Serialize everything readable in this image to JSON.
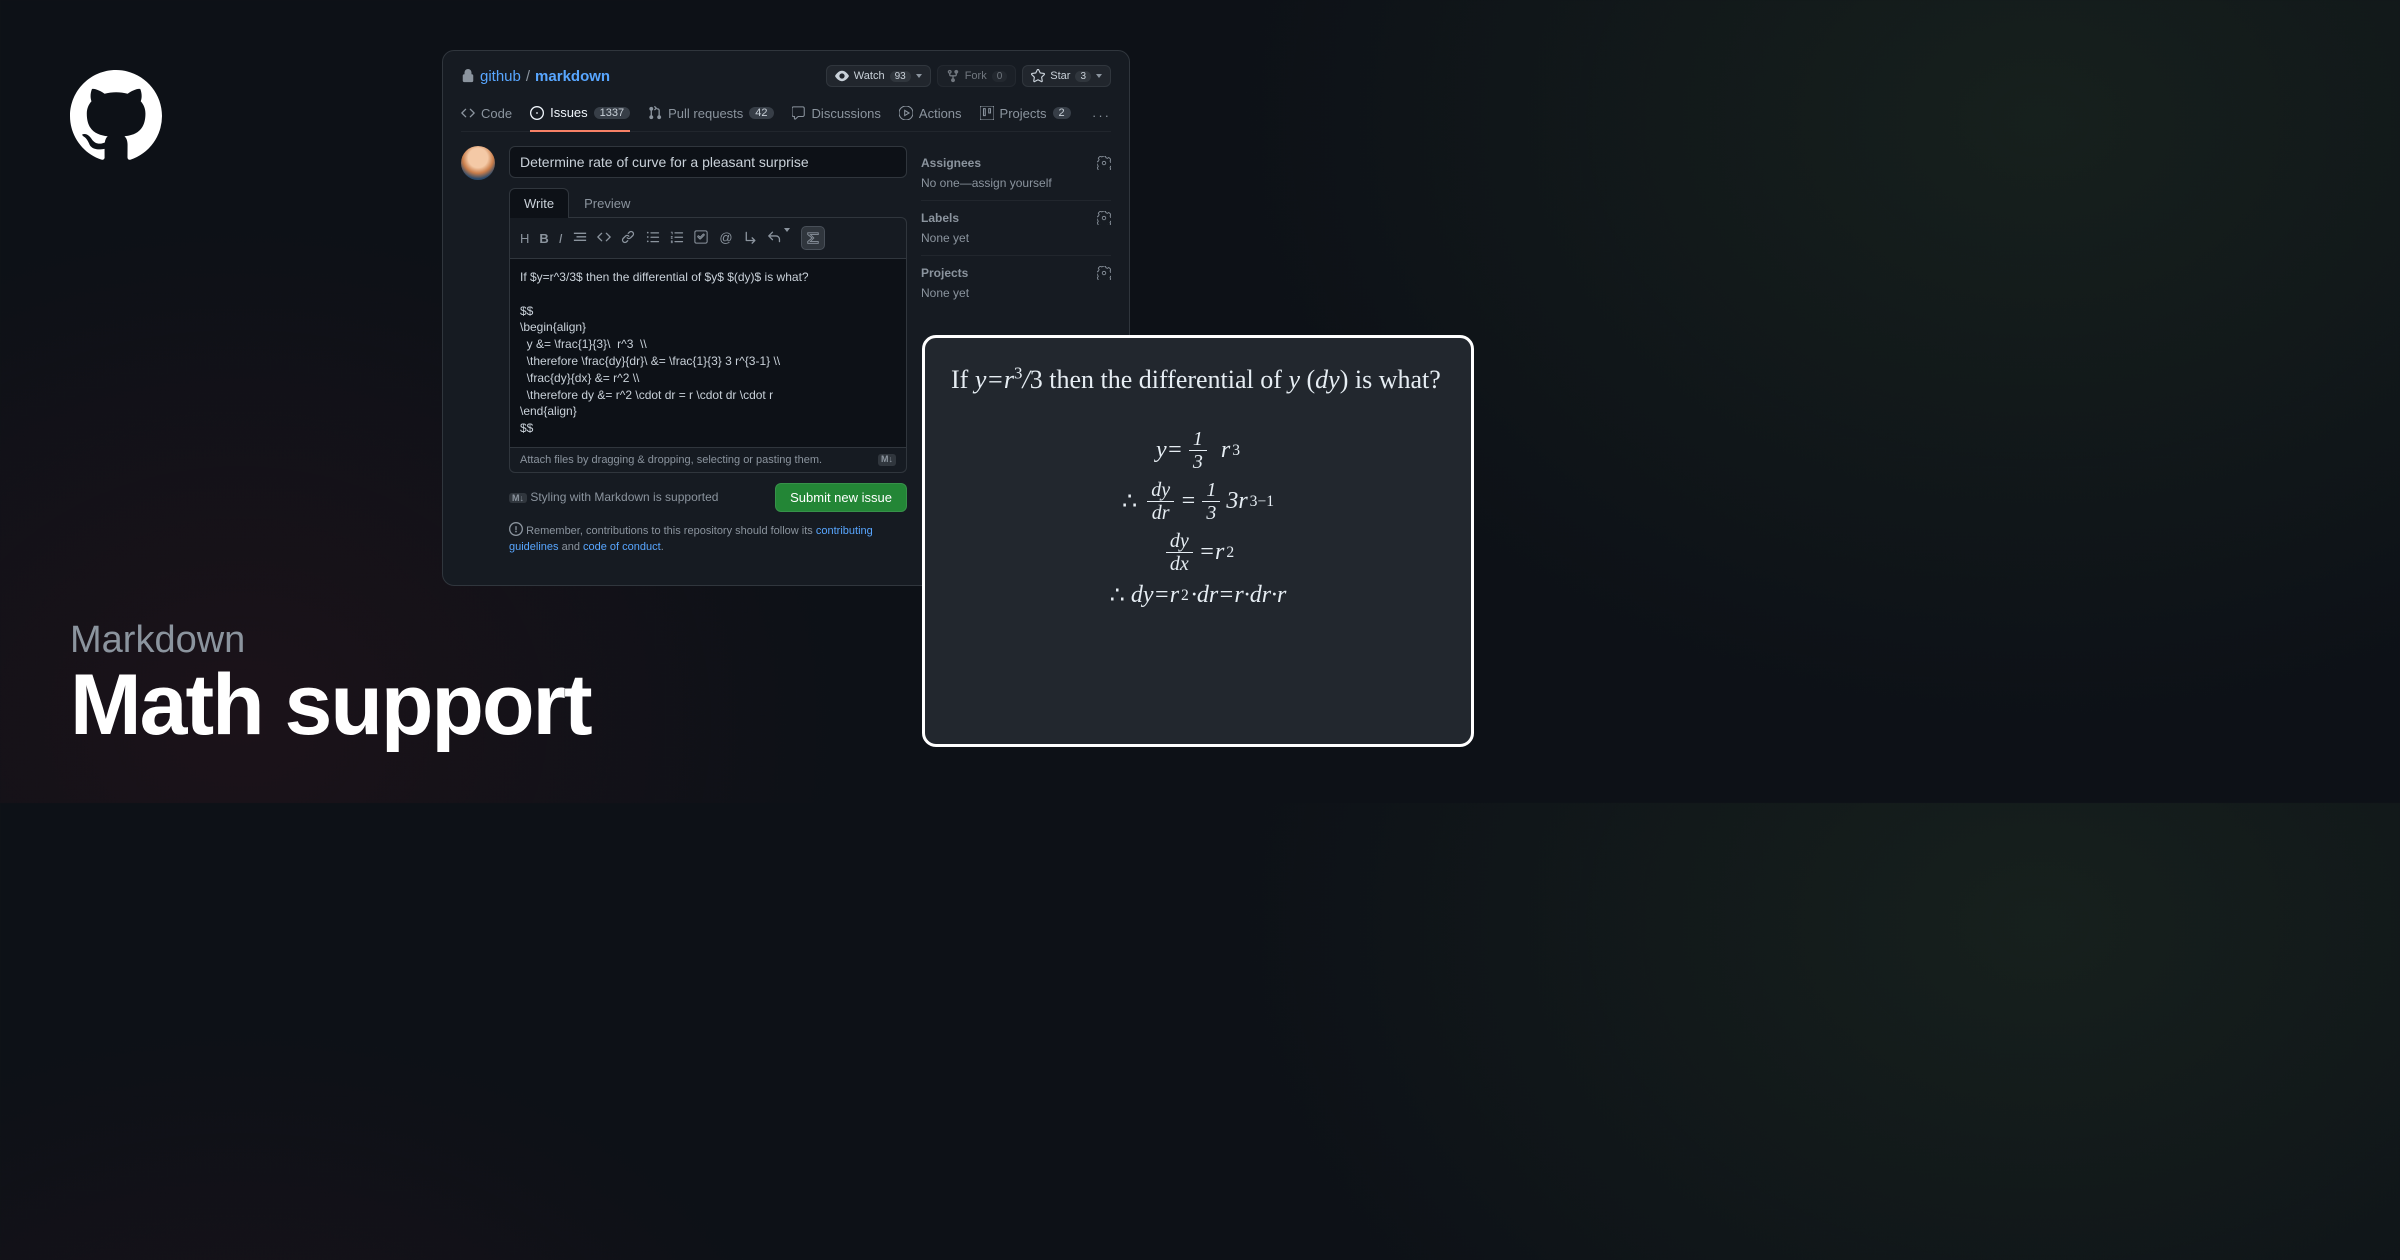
{
  "brand": "GitHub",
  "title": {
    "sub": "Markdown",
    "main": "Math support"
  },
  "breadcrumb": {
    "owner": "github",
    "repo": "markdown"
  },
  "repo_actions": {
    "watch": {
      "label": "Watch",
      "count": "93"
    },
    "fork": {
      "label": "Fork",
      "count": "0"
    },
    "star": {
      "label": "Star",
      "count": "3"
    }
  },
  "tabs": {
    "code": "Code",
    "issues": {
      "label": "Issues",
      "count": "1337"
    },
    "pulls": {
      "label": "Pull requests",
      "count": "42"
    },
    "discussions": "Discussions",
    "actions": "Actions",
    "projects": {
      "label": "Projects",
      "count": "2"
    }
  },
  "issue": {
    "title_value": "Determine rate of curve for a pleasant surprise",
    "write_tab": "Write",
    "preview_tab": "Preview",
    "body": "If $y=r^3/3$ then the differential of $y$ $(dy)$ is what?\n\n$$\n\\begin{align}\n  y &= \\frac{1}{3}\\  r^3  \\\\\n  \\therefore \\frac{dy}{dr}\\ &= \\frac{1}{3} 3 r^{3-1} \\\\\n  \\frac{dy}{dx} &= r^2 \\\\\n  \\therefore dy &= r^2 \\cdot dr = r \\cdot dr \\cdot r\n\\end{align}\n$$",
    "attach_hint": "Attach files by dragging & dropping, selecting or pasting them.",
    "md_support": "Styling with Markdown is supported",
    "submit": "Submit new issue",
    "guidelines_pre": "Remember, contributions to this repository should follow its ",
    "guidelines_link": "contributing guidelines",
    "guidelines_mid": " and ",
    "conduct_link": "code of conduct",
    "guidelines_post": "."
  },
  "sidebar": {
    "assignees": {
      "title": "Assignees",
      "value": "No one—assign yourself"
    },
    "labels": {
      "title": "Labels",
      "value": "None yet"
    },
    "projects": {
      "title": "Projects",
      "value": "None yet"
    }
  },
  "preview": {
    "line1_a": "If ",
    "line1_b": " then the differential of ",
    "line1_c": " is what?"
  }
}
